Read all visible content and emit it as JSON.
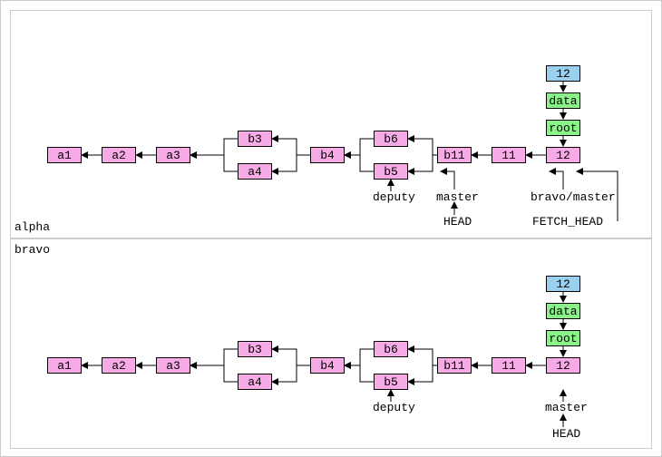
{
  "panels": {
    "alpha": "alpha",
    "bravo": "bravo"
  },
  "nodes": {
    "a1": "a1",
    "a2": "a2",
    "a3": "a3",
    "a4": "a4",
    "b3": "b3",
    "b4": "b4",
    "b5": "b5",
    "b6": "b6",
    "b11": "b11",
    "c11": "11",
    "c12": "12",
    "root": "root",
    "data": "data",
    "blob": "12"
  },
  "labels": {
    "deputy": "deputy",
    "master": "master",
    "head": "HEAD",
    "bravo_master": "bravo/master",
    "fetch_head": "FETCH_HEAD"
  },
  "chart_data": {
    "type": "dag",
    "description": "Git history graph after fetch, shown for two clones 'alpha' and 'bravo'",
    "commits": [
      "a1",
      "a2",
      "a3",
      "a4",
      "b3",
      "b4",
      "b5",
      "b6",
      "b11",
      "11",
      "12"
    ],
    "parents": {
      "a2": [
        "a1"
      ],
      "a3": [
        "a2"
      ],
      "a4": [
        "a3"
      ],
      "b3": [
        "a3"
      ],
      "b4": [
        "b3",
        "a4"
      ],
      "b5": [
        "b4"
      ],
      "b6": [
        "b4"
      ],
      "b11": [
        "b6",
        "b5"
      ],
      "11": [
        "b11"
      ],
      "12": [
        "11"
      ]
    },
    "tree_of_12": {
      "root": {
        "data": "12"
      }
    },
    "repos": {
      "alpha": {
        "refs": {
          "deputy": "b5",
          "master": "b11",
          "bravo/master": "12",
          "FETCH_HEAD": "12"
        },
        "HEAD_points_to": "master"
      },
      "bravo": {
        "refs": {
          "deputy": "b5",
          "master": "12"
        },
        "HEAD_points_to": "master"
      }
    }
  }
}
